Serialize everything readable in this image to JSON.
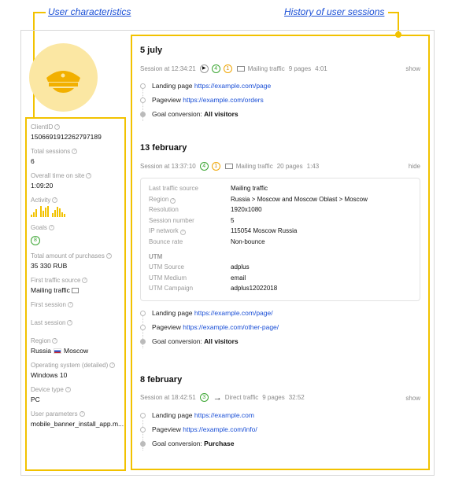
{
  "callouts": {
    "left": "User characteristics",
    "right": "History of user sessions"
  },
  "profile": {
    "client_id": {
      "label": "ClientID",
      "value": "1506691912262797189"
    },
    "total_sessions": {
      "label": "Total sessions",
      "value": "6"
    },
    "time_on_site": {
      "label": "Overall time on site",
      "value": "1:09:20"
    },
    "activity": {
      "label": "Activity"
    },
    "goals": {
      "label": "Goals",
      "value": "8"
    },
    "purchases": {
      "label": "Total amount of purchases",
      "value": "35 330 RUB"
    },
    "first_source": {
      "label": "First traffic source",
      "value": "Mailing traffic"
    },
    "first_session": {
      "label": "First session"
    },
    "last_session": {
      "label": "Last session"
    },
    "region": {
      "label": "Region",
      "country": "Russia",
      "city": "Moscow"
    },
    "os": {
      "label": "Operating system (detailed)",
      "value": "Windows 10"
    },
    "device": {
      "label": "Device type",
      "value": "PC"
    },
    "params": {
      "label": "User parameters",
      "value": "mobile_banner_install_app.m..."
    }
  },
  "sessions": [
    {
      "date": "5 july",
      "time": "Session at 12:34:21",
      "goals": "4",
      "orders": "1",
      "source": "Mailing traffic",
      "pages": "9 pages",
      "duration": "4:01",
      "action": "show",
      "events": [
        {
          "label": "Landing page",
          "link": "https://example.com/page"
        },
        {
          "label": "Pageview",
          "link": "https://example.com/orders"
        },
        {
          "label": "Goal conversion:",
          "bold": "All visitors"
        }
      ]
    },
    {
      "date": "13 february",
      "time": "Session at 13:37:10",
      "goals": "4",
      "orders": "1",
      "source": "Mailing traffic",
      "pages": "20 pages",
      "duration": "1:43",
      "action": "hide",
      "details": [
        {
          "k": "Last traffic source",
          "v": "Mailing traffic"
        },
        {
          "k": "Region",
          "v": "Russia > Moscow and Moscow Oblast > Moscow"
        },
        {
          "k": "Resolution",
          "v": "1920x1080"
        },
        {
          "k": "Session number",
          "v": "5"
        },
        {
          "k": "IP network",
          "v": "115054 Moscow Russia"
        },
        {
          "k": "Bounce rate",
          "v": "Non-bounce"
        }
      ],
      "utm_title": "UTM",
      "utm": [
        {
          "k": "UTM Source",
          "v": "adplus"
        },
        {
          "k": "UTM Medium",
          "v": "email"
        },
        {
          "k": "UTM Campaign",
          "v": "adplus12022018"
        }
      ],
      "events": [
        {
          "label": "Landing page",
          "link": "https://example.com/page/"
        },
        {
          "label": "Pageview",
          "link": "https://example.com/other-page/"
        },
        {
          "label": "Goal conversion:",
          "bold": "All visitors"
        }
      ]
    },
    {
      "date": "8 february",
      "time": "Session at 18:42:51",
      "goals": "3",
      "source": "Direct traffic",
      "pages": "9 pages",
      "duration": "32:52",
      "action": "show",
      "events": [
        {
          "label": "Landing page",
          "link": "https://example.com"
        },
        {
          "label": "Pageview",
          "link": "https://example.com/info/"
        },
        {
          "label": "Goal conversion:",
          "bold": "Purchase"
        }
      ]
    }
  ],
  "activity_bars": [
    3,
    6,
    10,
    14,
    8,
    12,
    14,
    5,
    9,
    13,
    11,
    6,
    4
  ],
  "colors": {
    "accent": "#f2c200",
    "link": "#1a4fd6",
    "goal": "#3aa531",
    "order": "#f0a500"
  },
  "icons": {
    "avatar": "police-cap-icon",
    "play": "play-icon",
    "mail": "envelope-icon",
    "arrow": "arrow-right-icon",
    "flag": "russia-flag-icon",
    "help": "question-icon"
  }
}
